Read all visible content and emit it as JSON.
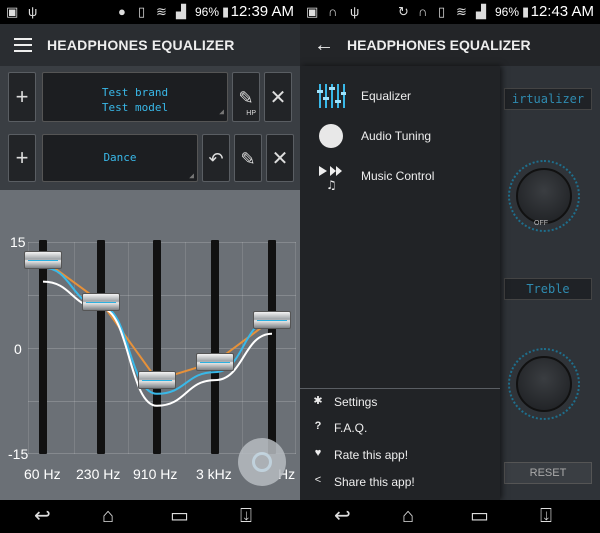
{
  "left": {
    "status": {
      "battery": "96%",
      "time": "12:39 AM"
    },
    "appbar": {
      "title": "HEADPHONES EQUALIZER"
    },
    "headphone_profile": {
      "brand": "Test brand",
      "model": "Test model",
      "hp_badge": "HP"
    },
    "eq_preset": {
      "name": "Dance"
    },
    "eq": {
      "y_labels": [
        "15",
        "0",
        "-15"
      ],
      "bands": [
        {
          "label": "60 Hz",
          "gain_db": 12.5
        },
        {
          "label": "230 Hz",
          "gain_db": 6.5
        },
        {
          "label": "910 Hz",
          "gain_db": -4.5
        },
        {
          "label": "3 kHz",
          "gain_db": -2.0
        },
        {
          "label": "Hz",
          "gain_db": 4.0
        }
      ]
    }
  },
  "right": {
    "status": {
      "battery": "96%",
      "time": "12:43 AM"
    },
    "appbar": {
      "title": "HEADPHONES EQUALIZER"
    },
    "drawer": {
      "items": [
        {
          "label": "Equalizer",
          "icon": "equalizer-icon"
        },
        {
          "label": "Audio Tuning",
          "icon": "audio-tuning-icon"
        },
        {
          "label": "Music Control",
          "icon": "music-control-icon"
        }
      ],
      "secondary": [
        {
          "label": "Settings",
          "icon": "gear-icon"
        },
        {
          "label": "F.A.Q.",
          "icon": "question-icon"
        },
        {
          "label": "Rate this app!",
          "icon": "heart-icon"
        },
        {
          "label": "Share this app!",
          "icon": "share-icon"
        }
      ]
    },
    "background": {
      "virtualizer_label": "irtualizer",
      "off_label": "OFF",
      "treble_label": "Treble",
      "reset_label": "RESET"
    }
  }
}
